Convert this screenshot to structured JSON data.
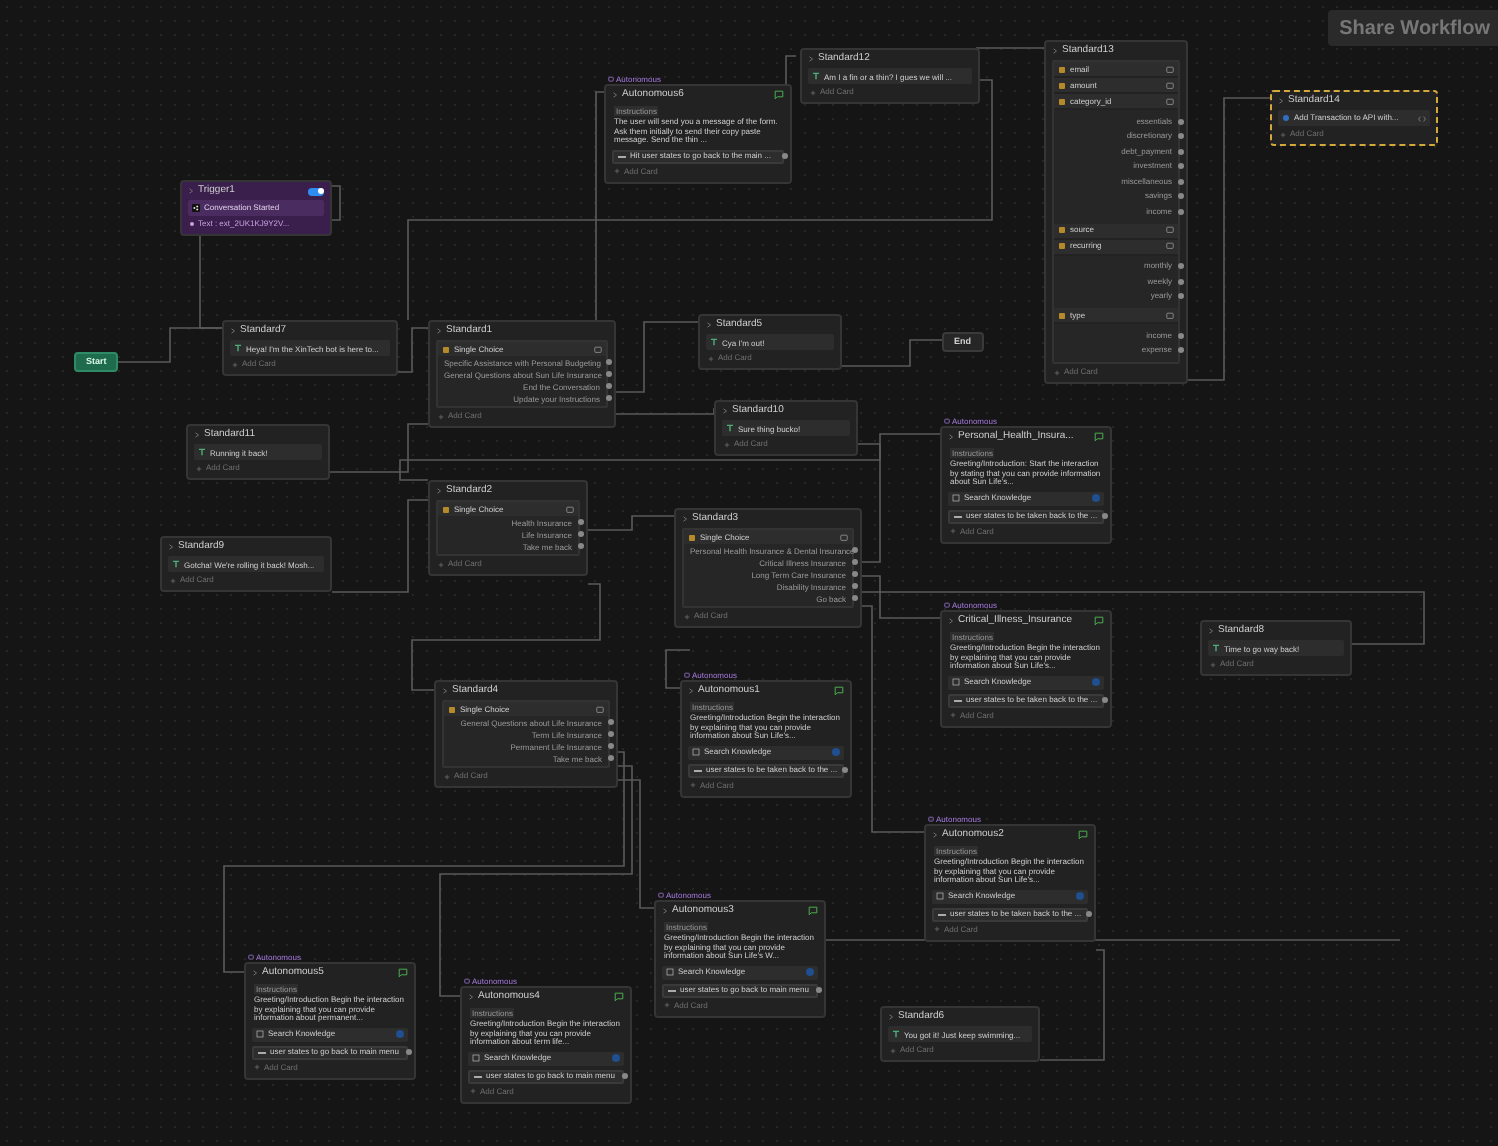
{
  "share_button": "Share Workflow",
  "nodes": [
    {
      "kind": "message",
      "title": "Standard12",
      "selected": false,
      "text": "Am I a fin or a thin? I gues we will ...",
      "add_card": "Add Card"
    },
    {
      "kind": "fields",
      "title": "Standard13",
      "selected": false,
      "groups": [
        {
          "field": "email"
        },
        {
          "field": "amount"
        },
        {
          "field": "category_id",
          "options": [
            "essentials",
            "discretionary",
            "debt_payment",
            "investment",
            "miscellaneous",
            "savings",
            "income"
          ]
        },
        {
          "field": "source"
        },
        {
          "field": "recurring",
          "options": [
            "monthly",
            "weekly",
            "yearly"
          ]
        },
        {
          "field": "type",
          "options": [
            "income",
            "expense"
          ]
        }
      ],
      "add_card": "Add Card"
    },
    {
      "kind": "agent",
      "tag": "Autonomous",
      "title": "Autonomous6",
      "selected": false,
      "section": "Instructions",
      "instructions": "The user will send you a message of the form. Ask them initially to send their copy paste message. Send the thin ...",
      "exit": "Hit user states to go back to the main ...",
      "add_card": "Add Card"
    },
    {
      "kind": "api",
      "title": "Standard14",
      "selected": true,
      "text": "Add Transaction to API with...",
      "add_card": "Add Card"
    },
    {
      "kind": "trigger",
      "title": "Trigger1",
      "selected": false,
      "enabled": true,
      "event": "Conversation Started",
      "footer": "Text : ext_2UK1KJ9Y2V..."
    },
    {
      "kind": "message",
      "title": "Standard5",
      "selected": false,
      "text": "Cya I'm out!",
      "add_card": "Add Card"
    },
    {
      "kind": "message",
      "title": "Standard7",
      "selected": false,
      "text": "Heya! I'm the XinTech bot is here to...",
      "add_card": "Add Card"
    },
    {
      "kind": "choice",
      "title": "Standard1",
      "selected": false,
      "card": "Single Choice",
      "options": [
        "Specific Assistance with Personal Budgeting",
        "General Questions about Sun Life Insurance",
        "End the Conversation",
        "Update your Instructions"
      ],
      "add_card": "Add Card"
    },
    {
      "kind": "end",
      "title": "End",
      "selected": false
    },
    {
      "kind": "start",
      "title": "Start",
      "selected": false
    },
    {
      "kind": "message",
      "title": "Standard10",
      "selected": false,
      "text": "Sure thing bucko!",
      "add_card": "Add Card"
    },
    {
      "kind": "message",
      "title": "Standard11",
      "selected": false,
      "text": "Running it back!",
      "add_card": "Add Card"
    },
    {
      "kind": "agent",
      "tag": "Autonomous",
      "title": "Personal_Health_Insura...",
      "selected": false,
      "section": "Instructions",
      "instructions": "Greeting/Introduction: Start the interaction by stating that you can provide information about Sun Life's...",
      "tool": "Search Knowledge",
      "exit": "user states to be taken back to the ...",
      "add_card": "Add Card"
    },
    {
      "kind": "choice",
      "title": "Standard2",
      "selected": false,
      "card": "Single Choice",
      "options": [
        "Health Insurance",
        "Life Insurance",
        "Take me back"
      ],
      "add_card": "Add Card"
    },
    {
      "kind": "choice",
      "title": "Standard3",
      "selected": false,
      "card": "Single Choice",
      "options": [
        "Personal Health Insurance & Dental Insurance",
        "Critical Illness Insurance",
        "Long Term Care Insurance",
        "Disability Insurance",
        "Go back"
      ],
      "add_card": "Add Card"
    },
    {
      "kind": "message",
      "title": "Standard9",
      "selected": false,
      "text": "Gotcha! We're rolling it back! Mosh...",
      "add_card": "Add Card"
    },
    {
      "kind": "agent",
      "tag": "Autonomous",
      "title": "Critical_Illness_Insurance",
      "selected": false,
      "section": "Instructions",
      "instructions": "Greeting/Introduction Begin the interaction by explaining that you can provide information about Sun Life's...",
      "tool": "Search Knowledge",
      "exit": "user states to be taken back to the ...",
      "add_card": "Add Card"
    },
    {
      "kind": "message",
      "title": "Standard8",
      "selected": false,
      "text": "Time to go way back!",
      "add_card": "Add Card"
    },
    {
      "kind": "choice",
      "title": "Standard4",
      "selected": false,
      "card": "Single Choice",
      "options": [
        "General Questions about Life Insurance",
        "Term Life Insurance",
        "Permanent Life Insurance",
        "Take me back"
      ],
      "add_card": "Add Card"
    },
    {
      "kind": "agent",
      "tag": "Autonomous",
      "title": "Autonomous1",
      "selected": false,
      "section": "Instructions",
      "instructions": "Greeting/Introduction Begin the interaction by explaining that you can provide information about Sun Life's...",
      "tool": "Search Knowledge",
      "exit": "user states to be taken back to the ...",
      "add_card": "Add Card"
    },
    {
      "kind": "agent",
      "tag": "Autonomous",
      "title": "Autonomous2",
      "selected": false,
      "section": "Instructions",
      "instructions": "Greeting/Introduction Begin the interaction by explaining that you can provide information about Sun Life's...",
      "tool": "Search Knowledge",
      "exit": "user states to be taken back to the ...",
      "add_card": "Add Card"
    },
    {
      "kind": "agent",
      "tag": "Autonomous",
      "title": "Autonomous3",
      "selected": false,
      "section": "Instructions",
      "instructions": "Greeting/Introduction Begin the interaction by explaining that you can provide information about Sun Life's W...",
      "tool": "Search Knowledge",
      "exit": "user states to go back to main menu",
      "add_card": "Add Card"
    },
    {
      "kind": "agent",
      "tag": "Autonomous",
      "title": "Autonomous5",
      "selected": false,
      "section": "Instructions",
      "instructions": "Greeting/Introduction Begin the interaction by explaining that you can provide information about permanent...",
      "tool": "Search Knowledge",
      "exit": "user states to go back to main menu",
      "add_card": "Add Card"
    },
    {
      "kind": "agent",
      "tag": "Autonomous",
      "title": "Autonomous4",
      "selected": false,
      "section": "Instructions",
      "instructions": "Greeting/Introduction Begin the interaction by explaining that you can provide information about term life...",
      "tool": "Search Knowledge",
      "exit": "user states to go back to main menu",
      "add_card": "Add Card"
    },
    {
      "kind": "message",
      "title": "Standard6",
      "selected": false,
      "text": "You got it! Just keep swimming...",
      "add_card": "Add Card"
    }
  ]
}
